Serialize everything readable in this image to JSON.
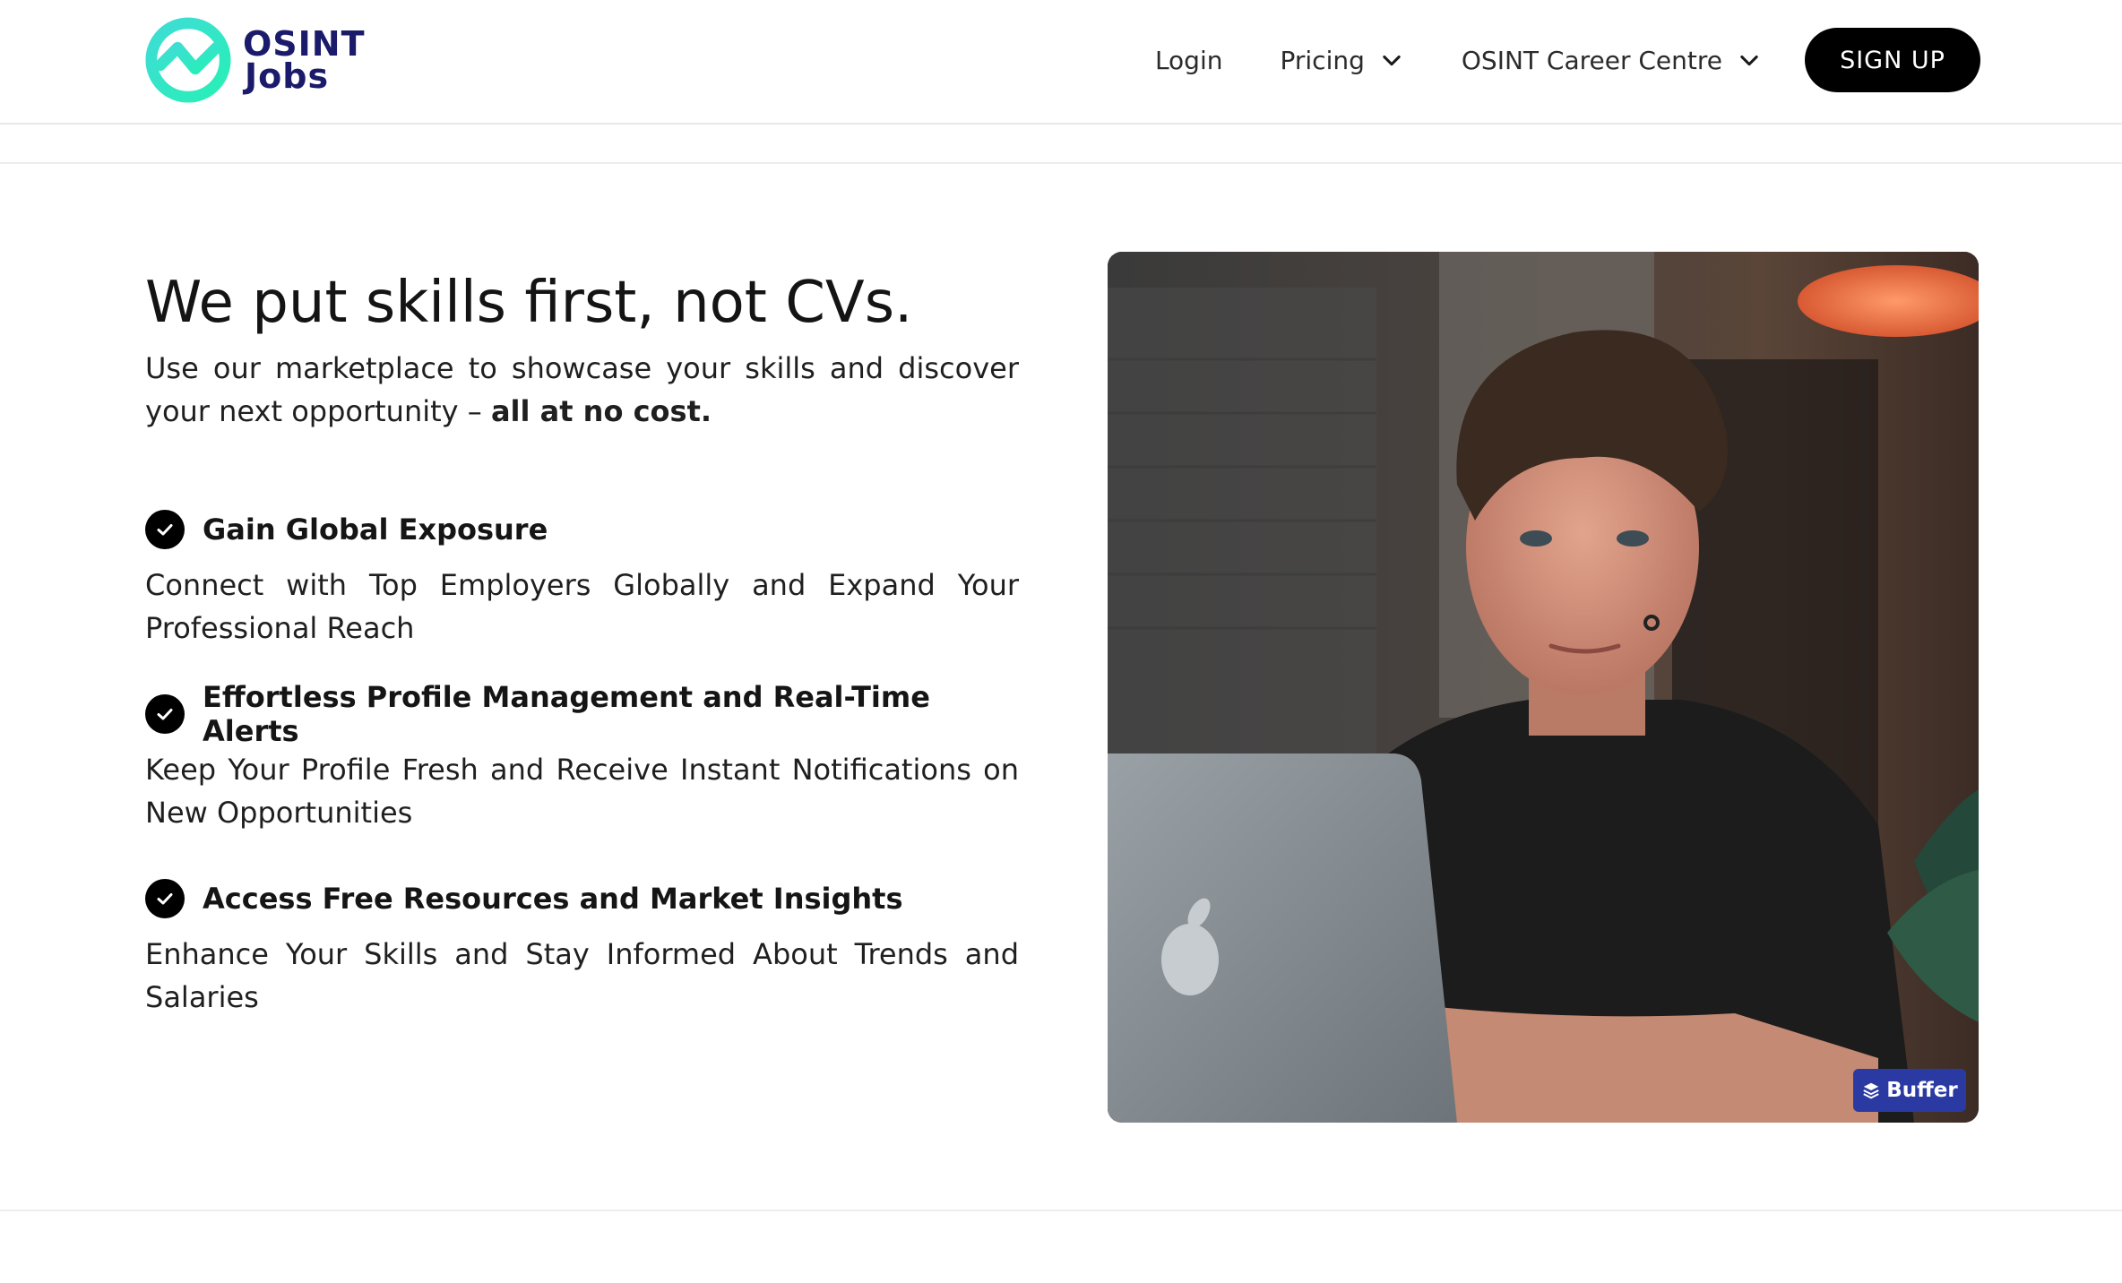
{
  "header": {
    "logo": {
      "line1": "OSINT",
      "line2": "Jobs"
    },
    "nav": {
      "login": "Login",
      "pricing": "Pricing",
      "career_centre": "OSINT Career Centre",
      "signup": "SIGN UP"
    }
  },
  "hero": {
    "headline": "We put skills first, not CVs.",
    "subtext_prefix": "Use our marketplace to showcase your skills and discover your next opportunity – ",
    "subtext_bold": "all at no cost.",
    "features": [
      {
        "title": "Gain Global Exposure",
        "description": "Connect with Top Employers Globally and Expand Your Professional Reach"
      },
      {
        "title": "Effortless Profile Management and Real-Time Alerts",
        "description": "Keep Your Profile Fresh and Receive Instant Notifications on New Opportunities"
      },
      {
        "title": "Access Free Resources and Market Insights",
        "description": "Enhance Your Skills and Stay Informed About Trends and Salaries"
      }
    ],
    "image": {
      "badge": "Buffer"
    }
  },
  "colors": {
    "brand_navy": "#1b1b6b",
    "brand_teal": "#2ee6c9",
    "button_black": "#000000",
    "badge_blue": "#2b3aa3"
  }
}
